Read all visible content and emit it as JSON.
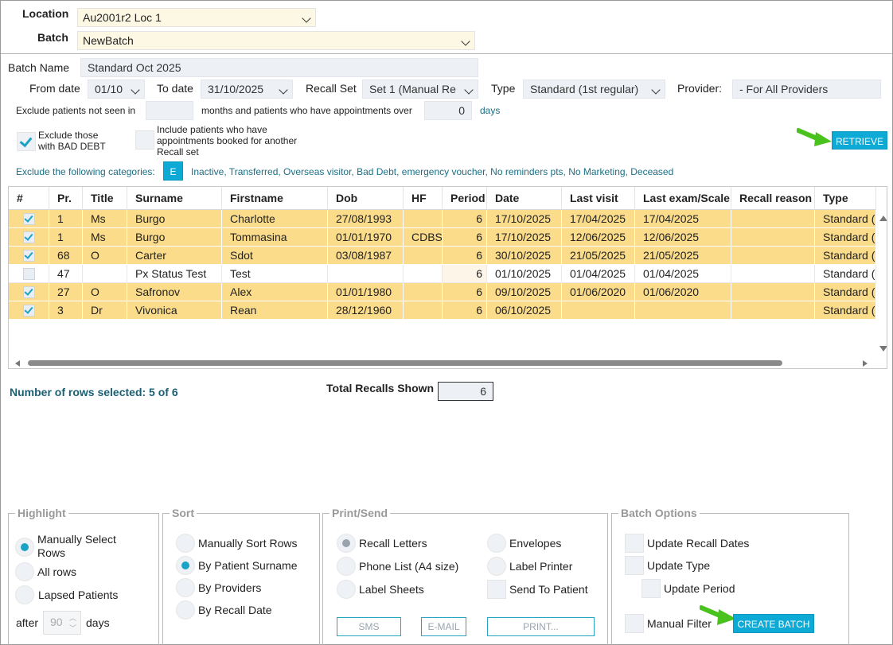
{
  "header": {
    "location_label": "Location",
    "location_value": "Au2001r2 Loc 1",
    "batch_label": "Batch",
    "batch_value": "NewBatch"
  },
  "form": {
    "batch_name_label": "Batch Name",
    "batch_name_value": "Standard Oct 2025",
    "from_date_label": "From date",
    "from_date_value": "01/10",
    "to_date_label": "To date",
    "to_date_value": "31/10/2025",
    "recall_set_label": "Recall Set",
    "recall_set_value": "Set 1 (Manual Re",
    "type_label": "Type",
    "type_value": "Standard (1st regular)",
    "provider_label": "Provider:",
    "provider_value": "- For All Providers",
    "exclude_seen_label": "Exclude patients not seen in",
    "exclude_seen_value": "",
    "months_label": "months and patients who have appointments over",
    "days_value": "0",
    "days_label": "days",
    "bad_debt_label": "Exclude those with BAD DEBT",
    "include_booked_label": "Include patients who have appointments booked for another Recall set",
    "retrieve_label": "RETRIEVE",
    "exclude_cats_label": "Exclude the following categories:",
    "exclude_cats_button": "E",
    "exclude_cats_value": "Inactive, Transferred, Overseas visitor, Bad Debt, emergency voucher, No reminders pts, No Marketing, Deceased"
  },
  "table": {
    "columns": [
      "#",
      "Pr.",
      "Title",
      "Surname",
      "Firstname",
      "Dob",
      "HF",
      "Period",
      "Date",
      "Last visit",
      "Last exam/Scale",
      "Recall reason",
      "Type"
    ],
    "rows": [
      {
        "checked": true,
        "pr": "1",
        "title": "Ms",
        "surname": "Burgo",
        "firstname": "Charlotte",
        "dob": "27/08/1993",
        "hf": "",
        "period": "6",
        "date": "17/10/2025",
        "last_visit": "17/04/2025",
        "last_exam": "17/04/2025",
        "reason": "",
        "type": "Standard ("
      },
      {
        "checked": true,
        "pr": "1",
        "title": "Ms",
        "surname": "Burgo",
        "firstname": "Tommasina",
        "dob": "01/01/1970",
        "hf": "CDBS",
        "period": "6",
        "date": "17/10/2025",
        "last_visit": "12/06/2025",
        "last_exam": "12/06/2025",
        "reason": "",
        "type": "Standard ("
      },
      {
        "checked": true,
        "pr": "68",
        "title": "O",
        "surname": "Carter",
        "firstname": "Sdot",
        "dob": "03/08/1987",
        "hf": "",
        "period": "6",
        "date": "30/10/2025",
        "last_visit": "21/05/2025",
        "last_exam": "21/05/2025",
        "reason": "",
        "type": "Standard ("
      },
      {
        "checked": false,
        "pr": "47",
        "title": "",
        "surname": "Px Status Test",
        "firstname": "Test",
        "dob": "",
        "hf": "",
        "period": "6",
        "date": "01/10/2025",
        "last_visit": "01/04/2025",
        "last_exam": "01/04/2025",
        "reason": "",
        "type": "Standard ("
      },
      {
        "checked": true,
        "pr": "27",
        "title": "O",
        "surname": "Safronov",
        "firstname": "Alex",
        "dob": "01/01/1980",
        "hf": "",
        "period": "6",
        "date": "09/10/2025",
        "last_visit": "01/06/2020",
        "last_exam": "01/06/2020",
        "reason": "",
        "type": "Standard ("
      },
      {
        "checked": true,
        "pr": "3",
        "title": "Dr",
        "surname": "Vivonica",
        "firstname": "Rean",
        "dob": "28/12/1960",
        "hf": "",
        "period": "6",
        "date": "06/10/2025",
        "last_visit": "",
        "last_exam": "",
        "reason": "",
        "type": "Standard ("
      }
    ]
  },
  "summary": {
    "rows_selected": "Number of rows selected: 5 of 6",
    "total_label": "Total Recalls Shown",
    "total_value": "6"
  },
  "highlight": {
    "title": "Highlight",
    "manual": "Manually Select Rows",
    "all": "All rows",
    "lapsed": "Lapsed Patients",
    "after_label": "after",
    "after_value": "90",
    "days_label": "days"
  },
  "sort": {
    "title": "Sort",
    "manual": "Manually Sort Rows",
    "surname": "By Patient Surname",
    "providers": "By Providers",
    "recall_date": "By Recall Date"
  },
  "print": {
    "title": "Print/Send",
    "letters": "Recall Letters",
    "phone": "Phone List (A4 size)",
    "sheets": "Label Sheets",
    "envelopes": "Envelopes",
    "printer": "Label Printer",
    "send": "Send To Patient",
    "sms": "SMS",
    "email": "E-MAIL",
    "print": "PRINT..."
  },
  "batch_options": {
    "title": "Batch Options",
    "update_dates": "Update Recall Dates",
    "update_type": "Update Type",
    "update_period": "Update Period",
    "manual_filter": "Manual Filter",
    "create": "CREATE BATCH"
  },
  "colors": {
    "accent": "#0eaad6",
    "selected_row": "#fbdc8a",
    "annotation_arrow": "#49c21e"
  }
}
